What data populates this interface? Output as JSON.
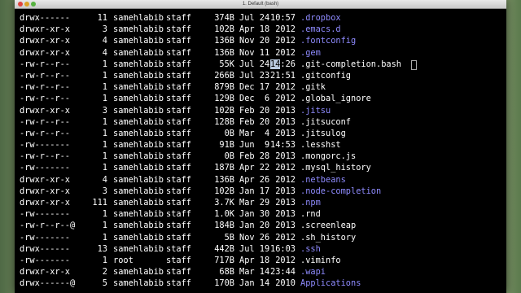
{
  "window": {
    "title": "1. Default (bash)"
  },
  "colors": {
    "terminal_background": "#000000",
    "text": "#ffffff",
    "directory": "#8f8bff",
    "selection": "#b9c9df"
  },
  "listing": [
    {
      "perm": "drwx------",
      "links": "11",
      "owner": "samehlabib",
      "group": "staff",
      "size": "374B",
      "date": "Jul 24",
      "time": "10:57",
      "name": ".dropbox",
      "type": "dir"
    },
    {
      "perm": "drwxr-xr-x",
      "links": "3",
      "owner": "samehlabib",
      "group": "staff",
      "size": "102B",
      "date": "Apr 18",
      "time": "2012",
      "name": ".emacs.d",
      "type": "dir"
    },
    {
      "perm": "drwxr-xr-x",
      "links": "4",
      "owner": "samehlabib",
      "group": "staff",
      "size": "136B",
      "date": "Nov 20",
      "time": "2012",
      "name": ".fontconfig",
      "type": "dir"
    },
    {
      "perm": "drwxr-xr-x",
      "links": "4",
      "owner": "samehlabib",
      "group": "staff",
      "size": "136B",
      "date": "Nov 11",
      "time": "2012",
      "name": ".gem",
      "type": "dir"
    },
    {
      "perm": "-rw-r--r--",
      "links": "1",
      "owner": "samehlabib",
      "group": "staff",
      "size": "55K",
      "date": "Jul 24",
      "time_sel": "14",
      "time_rest": ":26",
      "name": ".git-completion.bash",
      "type": "file",
      "cursor_after": true
    },
    {
      "perm": "-rw-r--r--",
      "links": "1",
      "owner": "samehlabib",
      "group": "staff",
      "size": "266B",
      "date": "Jul 23",
      "time": "21:51",
      "name": ".gitconfig",
      "type": "file"
    },
    {
      "perm": "-rw-r--r--",
      "links": "1",
      "owner": "samehlabib",
      "group": "staff",
      "size": "879B",
      "date": "Dec 17",
      "time": "2012",
      "name": ".gitk",
      "type": "file"
    },
    {
      "perm": "-rw-r--r--",
      "links": "1",
      "owner": "samehlabib",
      "group": "staff",
      "size": "129B",
      "date": "Dec  6",
      "time": "2012",
      "name": ".global_ignore",
      "type": "file"
    },
    {
      "perm": "drwxr-xr-x",
      "links": "3",
      "owner": "samehlabib",
      "group": "staff",
      "size": "102B",
      "date": "Feb 20",
      "time": "2013",
      "name": ".jitsu",
      "type": "dir"
    },
    {
      "perm": "-rw-r--r--",
      "links": "1",
      "owner": "samehlabib",
      "group": "staff",
      "size": "128B",
      "date": "Feb 20",
      "time": "2013",
      "name": ".jitsuconf",
      "type": "file"
    },
    {
      "perm": "-rw-r--r--",
      "links": "1",
      "owner": "samehlabib",
      "group": "staff",
      "size": "0B",
      "date": "Mar  4",
      "time": "2013",
      "name": ".jitsulog",
      "type": "file"
    },
    {
      "perm": "-rw-------",
      "links": "1",
      "owner": "samehlabib",
      "group": "staff",
      "size": "91B",
      "date": "Jun  9",
      "time": "14:53",
      "name": ".lesshst",
      "type": "file"
    },
    {
      "perm": "-rw-r--r--",
      "links": "1",
      "owner": "samehlabib",
      "group": "staff",
      "size": "0B",
      "date": "Feb 28",
      "time": "2013",
      "name": ".mongorc.js",
      "type": "file"
    },
    {
      "perm": "-rw-------",
      "links": "1",
      "owner": "samehlabib",
      "group": "staff",
      "size": "187B",
      "date": "Apr 22",
      "time": "2012",
      "name": ".mysql_history",
      "type": "file"
    },
    {
      "perm": "drwxr-xr-x",
      "links": "4",
      "owner": "samehlabib",
      "group": "staff",
      "size": "136B",
      "date": "Apr 26",
      "time": "2012",
      "name": ".netbeans",
      "type": "dir"
    },
    {
      "perm": "drwxr-xr-x",
      "links": "3",
      "owner": "samehlabib",
      "group": "staff",
      "size": "102B",
      "date": "Jan 17",
      "time": "2013",
      "name": ".node-completion",
      "type": "dir"
    },
    {
      "perm": "drwxr-xr-x",
      "links": "111",
      "owner": "samehlabib",
      "group": "staff",
      "size": "3.7K",
      "date": "Mar 29",
      "time": "2013",
      "name": ".npm",
      "type": "dir"
    },
    {
      "perm": "-rw-------",
      "links": "1",
      "owner": "samehlabib",
      "group": "staff",
      "size": "1.0K",
      "date": "Jan 30",
      "time": "2013",
      "name": ".rnd",
      "type": "file"
    },
    {
      "perm": "-rw-r--r--@",
      "links": "1",
      "owner": "samehlabib",
      "group": "staff",
      "size": "184B",
      "date": "Jan 20",
      "time": "2013",
      "name": ".screenleap",
      "type": "file"
    },
    {
      "perm": "-rw-------",
      "links": "1",
      "owner": "samehlabib",
      "group": "staff",
      "size": "5B",
      "date": "Nov 26",
      "time": "2012",
      "name": ".sh_history",
      "type": "file"
    },
    {
      "perm": "drwx------",
      "links": "13",
      "owner": "samehlabib",
      "group": "staff",
      "size": "442B",
      "date": "Jul 19",
      "time": "16:03",
      "name": ".ssh",
      "type": "dir"
    },
    {
      "perm": "-rw-------",
      "links": "1",
      "owner": "root",
      "group": "staff",
      "size": "717B",
      "date": "Apr 18",
      "time": "2012",
      "name": ".viminfo",
      "type": "file"
    },
    {
      "perm": "drwxr-xr-x",
      "links": "2",
      "owner": "samehlabib",
      "group": "staff",
      "size": "68B",
      "date": "Mar 14",
      "time": "23:44",
      "name": ".wapi",
      "type": "dir"
    },
    {
      "perm": "drwx------@",
      "links": "5",
      "owner": "samehlabib",
      "group": "staff",
      "size": "170B",
      "date": "Jan 14",
      "time": "2010",
      "name": "Applications",
      "type": "dir"
    }
  ]
}
